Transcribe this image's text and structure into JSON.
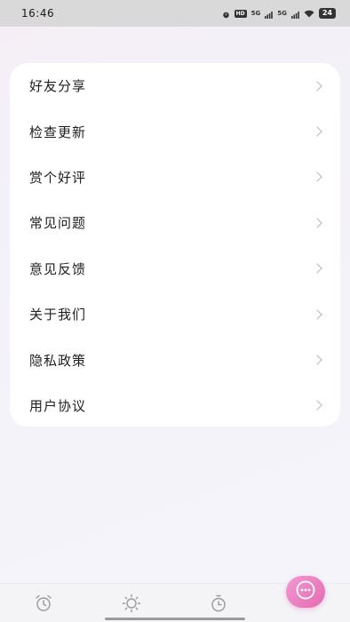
{
  "status_bar": {
    "time": "16:46",
    "icons": [
      "alarm-icon",
      "hd-icon",
      "signal-5g-icon",
      "signal-5g-icon",
      "wifi-icon"
    ],
    "hd_text": "HD",
    "net1": "5G",
    "net2": "5G",
    "battery": "24"
  },
  "menu": {
    "items": [
      {
        "label": "好友分享"
      },
      {
        "label": "检查更新"
      },
      {
        "label": "赏个好评"
      },
      {
        "label": "常见问题"
      },
      {
        "label": "意见反馈"
      },
      {
        "label": "关于我们"
      },
      {
        "label": "隐私政策"
      },
      {
        "label": "用户协议"
      }
    ]
  },
  "tab_bar": {
    "tabs": [
      {
        "icon": "alarm-clock-icon"
      },
      {
        "icon": "sun-icon"
      },
      {
        "icon": "timer-icon"
      },
      {
        "icon": "more-icon",
        "active": true
      }
    ],
    "accent_color": "#e97bbf"
  }
}
